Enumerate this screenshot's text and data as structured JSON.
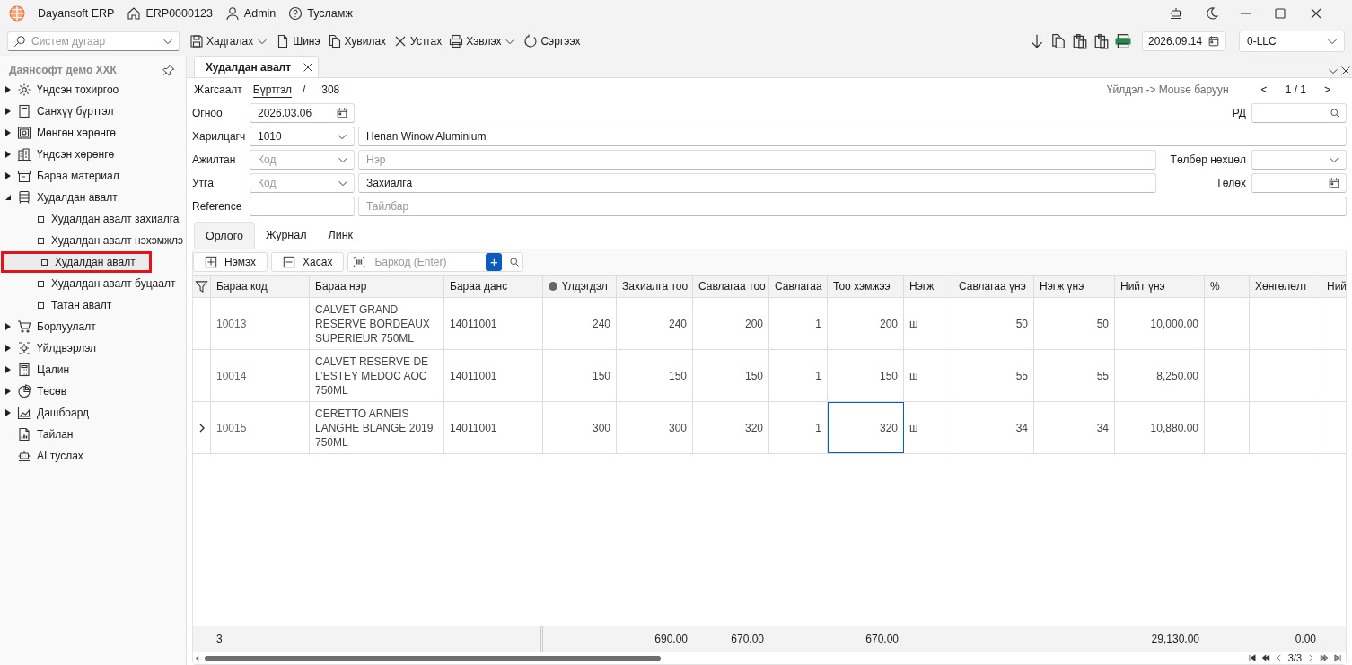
{
  "titlebar": {
    "app_name": "Dayansoft ERP",
    "record": "ERP0000123",
    "user": "Admin",
    "help": "Тусламж"
  },
  "toolbar": {
    "search": {
      "placeholder": "Систем дугаар"
    },
    "buttons": [
      {
        "label": "Хадгалах",
        "kind": "save",
        "dropdown": true
      },
      {
        "label": "Шинэ",
        "kind": "new",
        "dropdown": false
      },
      {
        "label": "Хувилах",
        "kind": "copy",
        "dropdown": false
      },
      {
        "label": "Устгах",
        "kind": "delete",
        "dropdown": false
      },
      {
        "label": "Хэвлэх",
        "kind": "print",
        "dropdown": true
      },
      {
        "label": "Сэргээх",
        "kind": "refresh",
        "dropdown": false
      }
    ],
    "date": "2026.09.14",
    "company": "0-LLC"
  },
  "sidebar": {
    "title": "Даянсофт демо ХХК",
    "items": [
      {
        "label": "Үндсэн тохиргоо",
        "kind": "settings",
        "expanded": false
      },
      {
        "label": "Санхүү бүртгэл",
        "kind": "ledger",
        "expanded": false
      },
      {
        "label": "Мөнгөн хөрөнгө",
        "kind": "cash",
        "expanded": false
      },
      {
        "label": "Үндсэн хөрөнгө",
        "kind": "building",
        "expanded": false
      },
      {
        "label": "Бараа материал",
        "kind": "box",
        "expanded": false
      },
      {
        "label": "Худалдан авалт",
        "kind": "receipt",
        "expanded": true,
        "children": [
          {
            "label": "Худалдан авалт захиалга",
            "selected": false
          },
          {
            "label": "Худалдан авалт нэхэмжлэ",
            "selected": false
          },
          {
            "label": "Худалдан авалт",
            "selected": true
          },
          {
            "label": "Худалдан авалт буцаалт",
            "selected": false
          },
          {
            "label": "Татан авалт",
            "selected": false
          }
        ]
      },
      {
        "label": "Борлуулалт",
        "kind": "cart",
        "expanded": false
      },
      {
        "label": "Үйлдвэрлэл",
        "kind": "factory",
        "expanded": false
      },
      {
        "label": "Цалин",
        "kind": "calculator",
        "expanded": false
      },
      {
        "label": "Төсөв",
        "kind": "pie",
        "expanded": false
      },
      {
        "label": "Дашбоард",
        "kind": "chart",
        "expanded": false
      },
      {
        "label": "Тайлан",
        "kind": "report"
      },
      {
        "label": "AI туслах",
        "kind": "robot"
      }
    ]
  },
  "doc_tabs": [
    {
      "label": "Худалдан авалт",
      "selected": true
    }
  ],
  "breadcrumb": {
    "items": [
      {
        "label": "Жагсаалт",
        "selected": false
      },
      {
        "label": "Бүртгэл",
        "selected": true
      }
    ],
    "separator": "/",
    "number": "308",
    "hint": "Үйлдэл -> Mouse баруун",
    "prev": "<",
    "position": "1 / 1",
    "next": ">"
  },
  "form": {
    "date": {
      "label": "Огноо",
      "value": "2026.03.06"
    },
    "rd": {
      "label": "РД"
    },
    "partner": {
      "label": "Харилцагч",
      "code": "1010",
      "name": "Henan Winow Aluminium"
    },
    "employee": {
      "label": "Ажилтан",
      "code_placeholder": "Код",
      "name_placeholder": "Нэр"
    },
    "payment_terms": {
      "label": "Төлбөр нөхцөл"
    },
    "purpose": {
      "label": "Утга",
      "code_placeholder": "Код",
      "text": "Захиалга"
    },
    "due": {
      "label": "Төлөх"
    },
    "reference": {
      "label": "Reference",
      "note_placeholder": "Тайлбар"
    }
  },
  "sub_tabs": [
    {
      "label": "Орлого",
      "selected": true
    },
    {
      "label": "Журнал",
      "selected": false
    },
    {
      "label": "Линк",
      "selected": false
    }
  ],
  "grid_toolbar": {
    "add": "Нэмэх",
    "remove": "Хасах",
    "barcode_placeholder": "Баркод (Enter)",
    "plus": "+"
  },
  "grid": {
    "columns": [
      {
        "name": "Бараа код",
        "kind": "text",
        "total": "3",
        "dot": false
      },
      {
        "name": "Бараа нэр",
        "kind": "text",
        "dot": false
      },
      {
        "name": "Бараа данс",
        "kind": "text",
        "dot": false
      },
      {
        "name": "Үлдэгдэл",
        "kind": "number",
        "dot": true
      },
      {
        "name": "Захиалга тоо",
        "kind": "number",
        "total": "690.00",
        "dot": false
      },
      {
        "name": "Савлагаа тоо",
        "kind": "number",
        "total": "670.00",
        "dot": false
      },
      {
        "name": "Савлагаа",
        "kind": "number",
        "dot": false
      },
      {
        "name": "Тоо хэмжээ",
        "kind": "number",
        "total": "670.00",
        "dot": false
      },
      {
        "name": "Нэгж",
        "kind": "text",
        "dot": false
      },
      {
        "name": "Савлагаа үнэ",
        "kind": "number",
        "dot": false
      },
      {
        "name": "Нэгж үнэ",
        "kind": "number",
        "dot": false
      },
      {
        "name": "Нийт үнэ",
        "kind": "number",
        "total": "29,130.00",
        "dot": false
      },
      {
        "name": "%",
        "kind": "number",
        "dot": false
      },
      {
        "name": "Хөнгөлөлт",
        "kind": "number",
        "total": "0.00",
        "dot": false
      },
      {
        "name": "Ний",
        "kind": "text",
        "dot": false
      }
    ],
    "rows": [
      {
        "current": false,
        "cells": [
          {
            "text": "10013",
            "focused": false
          },
          {
            "text": "CALVET GRAND RESERVE BORDEAUX SUPERIEUR 750ML",
            "focused": false
          },
          {
            "text": "14011001",
            "focused": false
          },
          {
            "text": "240",
            "focused": false
          },
          {
            "text": "240",
            "focused": false
          },
          {
            "text": "200",
            "focused": false
          },
          {
            "text": "1",
            "focused": false
          },
          {
            "text": "200",
            "focused": false
          },
          {
            "text": "ш",
            "focused": false
          },
          {
            "text": "50",
            "focused": false
          },
          {
            "text": "50",
            "focused": false
          },
          {
            "text": "10,000.00",
            "focused": false
          }
        ]
      },
      {
        "current": false,
        "cells": [
          {
            "text": "10014",
            "focused": false
          },
          {
            "text": "CALVET RESERVE DE L’ESTEY MEDOC AOC 750ML",
            "focused": false
          },
          {
            "text": "14011001",
            "focused": false
          },
          {
            "text": "150",
            "focused": false
          },
          {
            "text": "150",
            "focused": false
          },
          {
            "text": "150",
            "focused": false
          },
          {
            "text": "1",
            "focused": false
          },
          {
            "text": "150",
            "focused": false
          },
          {
            "text": "ш",
            "focused": false
          },
          {
            "text": "55",
            "focused": false
          },
          {
            "text": "55",
            "focused": false
          },
          {
            "text": "8,250.00",
            "focused": false
          }
        ]
      },
      {
        "current": true,
        "cells": [
          {
            "text": "10015",
            "focused": false
          },
          {
            "text": "CERETTO ARNEIS LANGHE BLANGE 2019 750ML",
            "focused": false
          },
          {
            "text": "14011001",
            "focused": false
          },
          {
            "text": "300",
            "focused": false
          },
          {
            "text": "300",
            "focused": false
          },
          {
            "text": "320",
            "focused": false
          },
          {
            "text": "1",
            "focused": false
          },
          {
            "text": "320",
            "focused": true
          },
          {
            "text": "ш",
            "focused": false
          },
          {
            "text": "34",
            "focused": false
          },
          {
            "text": "34",
            "focused": false
          },
          {
            "text": "10,880.00",
            "focused": false
          }
        ]
      }
    ],
    "pager": "3/3"
  }
}
